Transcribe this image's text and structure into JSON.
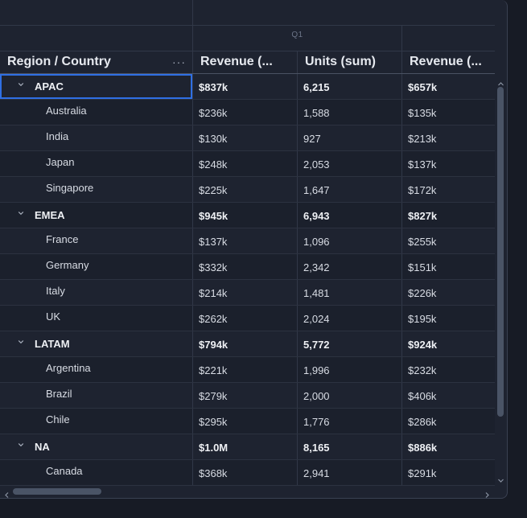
{
  "column_group": {
    "label": "Q1"
  },
  "columns": [
    {
      "key": "region",
      "label": "Region / Country"
    },
    {
      "key": "revenue",
      "label": "Revenue (..."
    },
    {
      "key": "units",
      "label": "Units (sum)"
    },
    {
      "key": "revenue_next",
      "label": "Revenue (..."
    }
  ],
  "column_menu_icon": "ellipsis-menu-icon",
  "rows": [
    {
      "type": "group",
      "name": "APAC",
      "revenue": "$837k",
      "units": "6,215",
      "revenue_next": "$657k"
    },
    {
      "type": "child",
      "name": "Australia",
      "revenue": "$236k",
      "units": "1,588",
      "revenue_next": "$135k"
    },
    {
      "type": "child",
      "name": "India",
      "revenue": "$130k",
      "units": "927",
      "revenue_next": "$213k"
    },
    {
      "type": "child",
      "name": "Japan",
      "revenue": "$248k",
      "units": "2,053",
      "revenue_next": "$137k"
    },
    {
      "type": "child",
      "name": "Singapore",
      "revenue": "$225k",
      "units": "1,647",
      "revenue_next": "$172k"
    },
    {
      "type": "group",
      "name": "EMEA",
      "revenue": "$945k",
      "units": "6,943",
      "revenue_next": "$827k"
    },
    {
      "type": "child",
      "name": "France",
      "revenue": "$137k",
      "units": "1,096",
      "revenue_next": "$255k"
    },
    {
      "type": "child",
      "name": "Germany",
      "revenue": "$332k",
      "units": "2,342",
      "revenue_next": "$151k"
    },
    {
      "type": "child",
      "name": "Italy",
      "revenue": "$214k",
      "units": "1,481",
      "revenue_next": "$226k"
    },
    {
      "type": "child",
      "name": "UK",
      "revenue": "$262k",
      "units": "2,024",
      "revenue_next": "$195k"
    },
    {
      "type": "group",
      "name": "LATAM",
      "revenue": "$794k",
      "units": "5,772",
      "revenue_next": "$924k"
    },
    {
      "type": "child",
      "name": "Argentina",
      "revenue": "$221k",
      "units": "1,996",
      "revenue_next": "$232k"
    },
    {
      "type": "child",
      "name": "Brazil",
      "revenue": "$279k",
      "units": "2,000",
      "revenue_next": "$406k"
    },
    {
      "type": "child",
      "name": "Chile",
      "revenue": "$295k",
      "units": "1,776",
      "revenue_next": "$286k"
    },
    {
      "type": "group",
      "name": "NA",
      "revenue": "$1.0M",
      "units": "8,165",
      "revenue_next": "$886k"
    },
    {
      "type": "child",
      "name": "Canada",
      "revenue": "$368k",
      "units": "2,941",
      "revenue_next": "$291k"
    }
  ],
  "colors": {
    "background": "#1e2330",
    "focus": "#2f6fe4",
    "text": "#d8dce4"
  }
}
